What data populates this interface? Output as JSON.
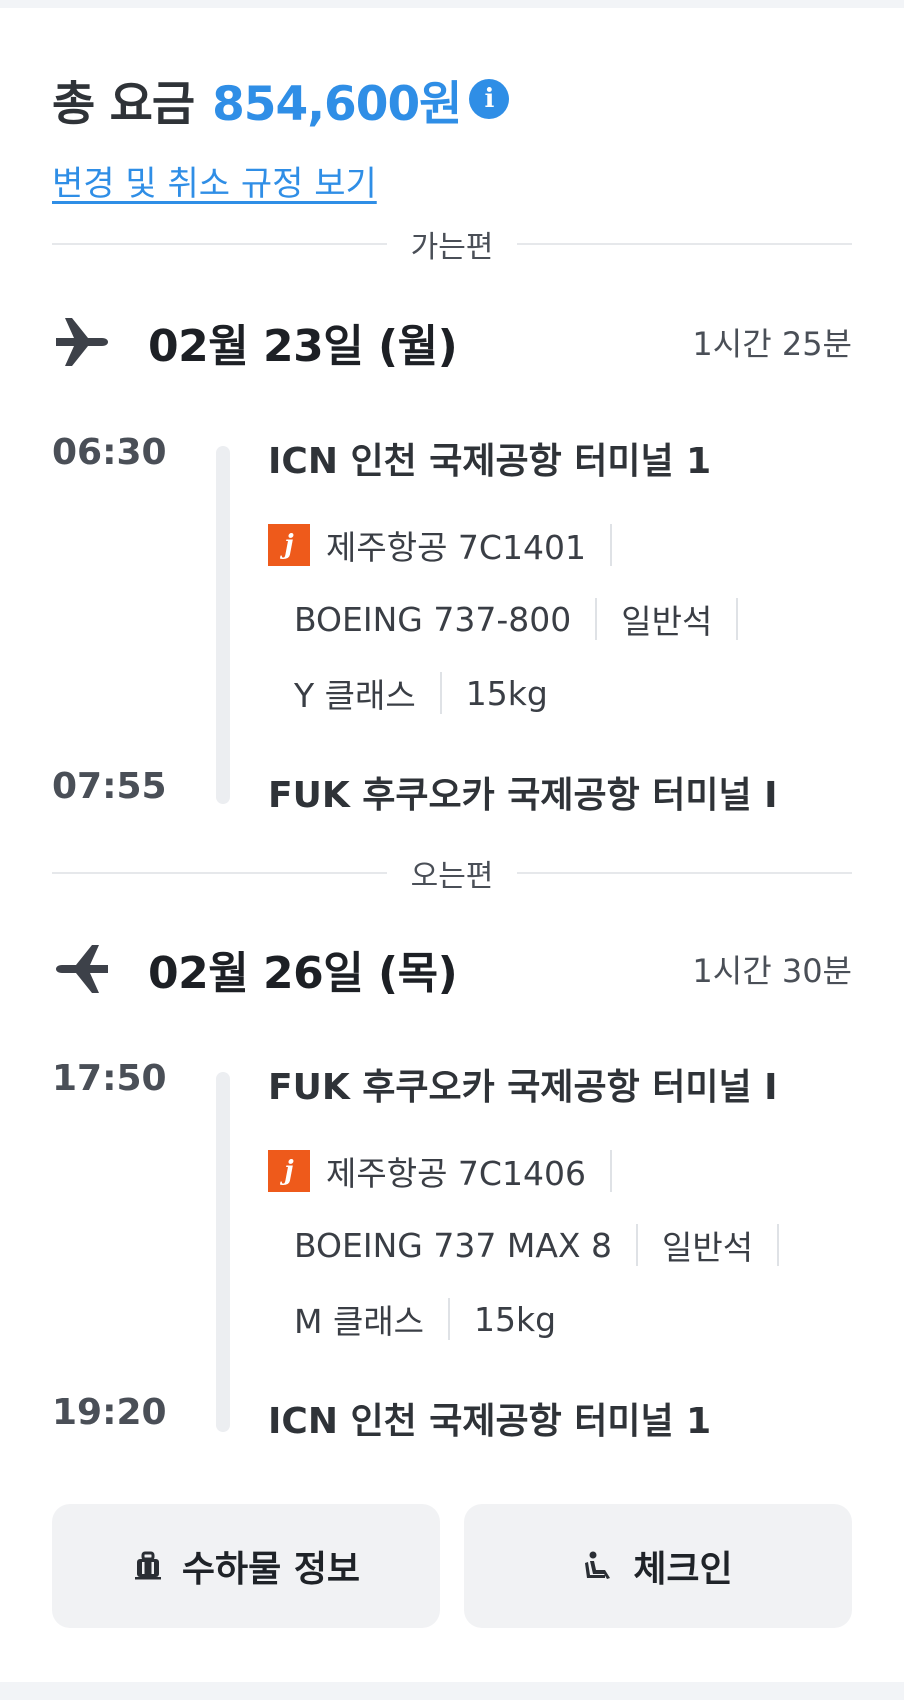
{
  "fare": {
    "label": "총 요금",
    "amount": "854,600원",
    "info_glyph": "i",
    "rules_link": "변경 및 취소 규정 보기"
  },
  "outbound": {
    "section_label": "가는편",
    "date": "02월 23일 (월)",
    "duration": "1시간 25분",
    "depart_time": "06:30",
    "depart_airport": "ICN 인천 국제공항 터미널 1",
    "airline_logo_text": "j",
    "airline": "제주항공 7C1401",
    "aircraft": "BOEING 737-800",
    "cabin": "일반석",
    "booking_class": "Y 클래스",
    "baggage": "15kg",
    "arrive_time": "07:55",
    "arrive_airport": "FUK 후쿠오카 국제공항 터미널 I"
  },
  "inbound": {
    "section_label": "오는편",
    "date": "02월 26일 (목)",
    "duration": "1시간 30분",
    "depart_time": "17:50",
    "depart_airport": "FUK 후쿠오카 국제공항 터미널 I",
    "airline_logo_text": "j",
    "airline": "제주항공 7C1406",
    "aircraft": "BOEING 737 MAX 8",
    "cabin": "일반석",
    "booking_class": "M 클래스",
    "baggage": "15kg",
    "arrive_time": "19:20",
    "arrive_airport": "ICN 인천 국제공항 터미널 1"
  },
  "actions": {
    "baggage_info": "수하물 정보",
    "checkin": "체크인"
  },
  "icons": {
    "plane": "airplane-icon",
    "info": "info-icon",
    "baggage": "luggage-icon",
    "checkin": "seat-icon"
  },
  "colors": {
    "accent": "#2f8ee6",
    "airline_brand": "#ee5a1b",
    "button_bg": "#f1f2f4"
  }
}
